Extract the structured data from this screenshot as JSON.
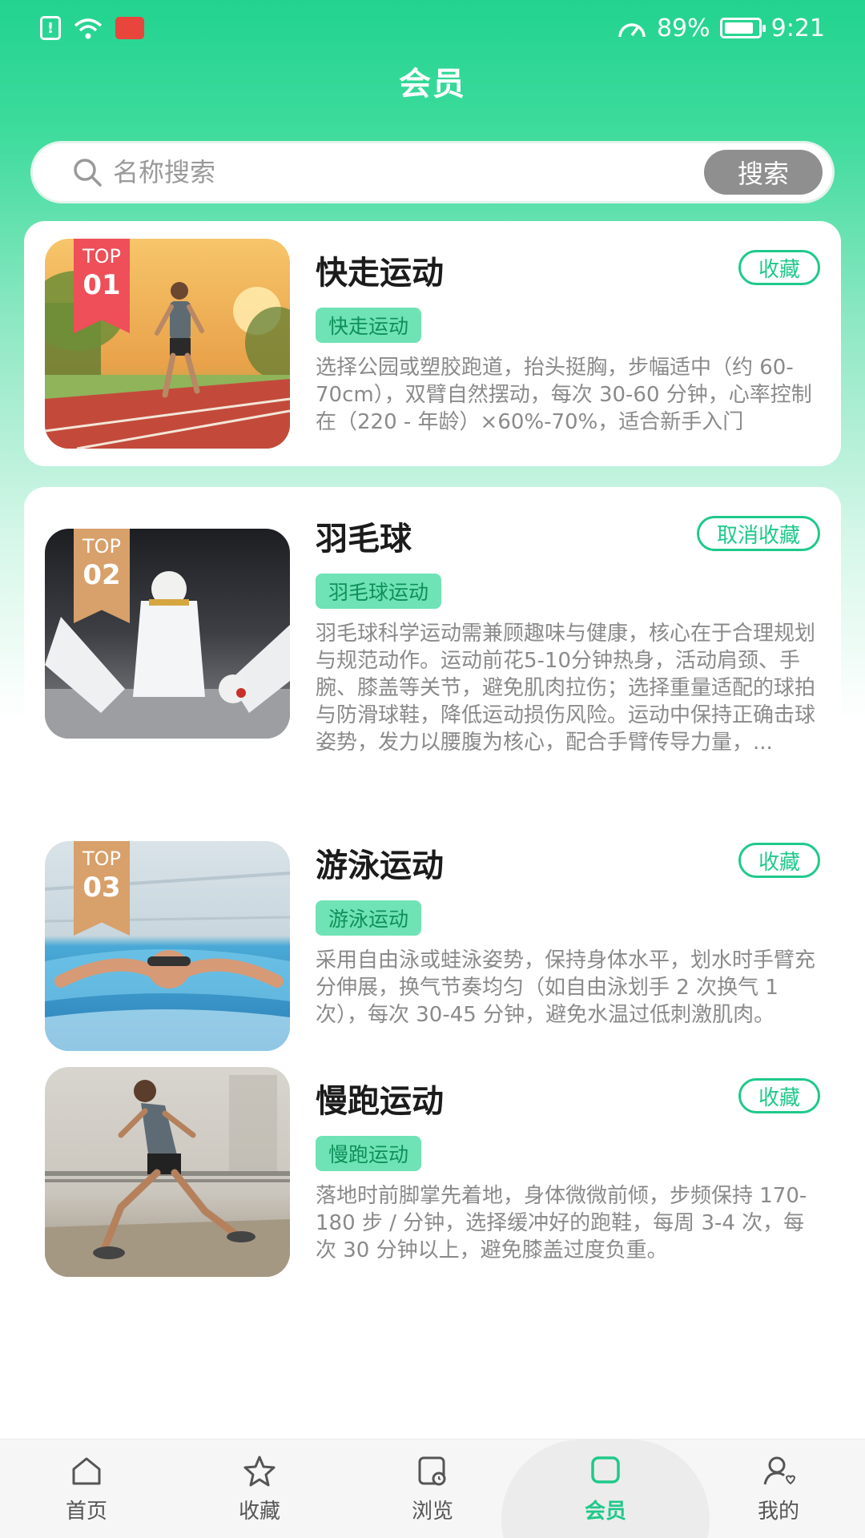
{
  "status_bar": {
    "battery": "89%",
    "time": "9:21",
    "battery_level": 0.89
  },
  "header": {
    "title": "会员"
  },
  "search": {
    "placeholder": "名称搜索",
    "button_label": "搜索"
  },
  "items": [
    {
      "rank_top": "TOP",
      "rank_num": "01",
      "title": "快走运动",
      "tag": "快走运动",
      "description": "选择公园或塑胶跑道，抬头挺胸，步幅适中（约 60-70cm），双臂自然摆动，每次 30-60 分钟，心率控制在（220 - 年龄）×60%-70%，适合新手入门",
      "fav_label": "收藏"
    },
    {
      "rank_top": "TOP",
      "rank_num": "02",
      "title": "羽毛球",
      "tag": "羽毛球运动",
      "description": "羽毛球科学运动需兼顾趣味与健康，核心在于合理规划与规范动作。运动前花5-10分钟热身，活动肩颈、手腕、膝盖等关节，避免肌肉拉伤；选择重量适配的球拍与防滑球鞋，降低运动损伤风险。运动中保持正确击球姿势，发力以腰腹为核心，配合手臂传导力量，...",
      "fav_label": "取消收藏"
    },
    {
      "rank_top": "TOP",
      "rank_num": "03",
      "title": "游泳运动",
      "tag": "游泳运动",
      "description": "采用自由泳或蛙泳姿势，保持身体水平，划水时手臂充分伸展，换气节奏均匀（如自由泳划手 2 次换气 1 次），每次 30-45 分钟，避免水温过低刺激肌肉。",
      "fav_label": "收藏"
    },
    {
      "title": "慢跑运动",
      "tag": "慢跑运动",
      "description": "落地时前脚掌先着地，身体微微前倾，步频保持 170-180 步 / 分钟，选择缓冲好的跑鞋，每周 3-4 次，每次 30 分钟以上，避免膝盖过度负重。",
      "fav_label": "收藏"
    }
  ],
  "tabbar": {
    "tabs": [
      {
        "label": "首页",
        "icon": "home-icon"
      },
      {
        "label": "收藏",
        "icon": "star-icon"
      },
      {
        "label": "浏览",
        "icon": "browse-icon"
      },
      {
        "label": "会员",
        "icon": "member-icon",
        "active": true
      },
      {
        "label": "我的",
        "icon": "profile-icon"
      }
    ]
  },
  "colors": {
    "accent": "#1fc98a",
    "header_green": "#22d38f",
    "tag_bg": "#6fe3b5",
    "rank_red": "#ee4f58",
    "rank_gold": "#d8a06a"
  }
}
